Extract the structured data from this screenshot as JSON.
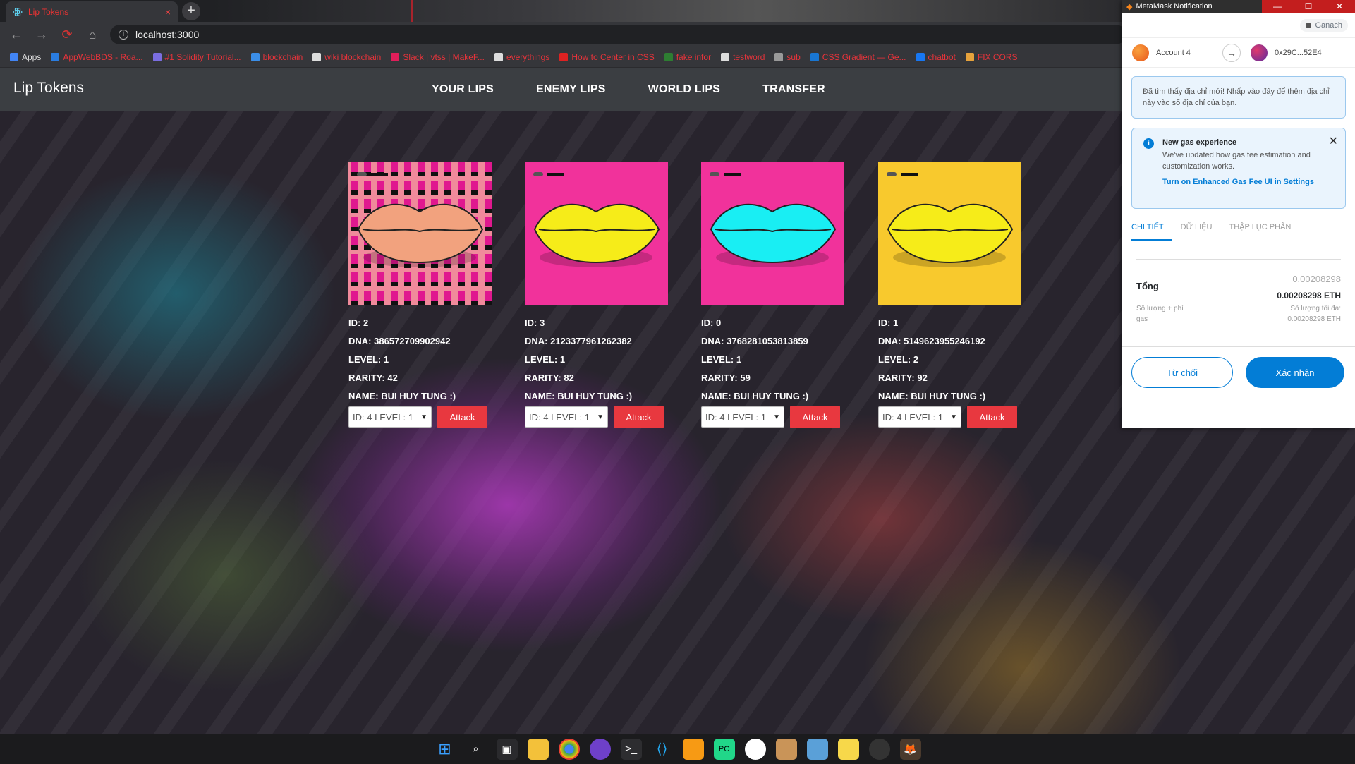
{
  "browser": {
    "tab_title": "Lip Tokens",
    "tab_close": "×",
    "new_tab": "+",
    "url": "localhost:3000",
    "bookmarks": [
      {
        "label": "Apps",
        "color": "#4285f4"
      },
      {
        "label": "AppWebBDS - Roa...",
        "color": "#2a7de1"
      },
      {
        "label": "#1 Solidity Tutorial...",
        "color": "#7b6ee0"
      },
      {
        "label": "blockchain",
        "color": "#3b8ee8"
      },
      {
        "label": "wiki blockchain",
        "color": "#dddddd"
      },
      {
        "label": "Slack | vtss | MakeF...",
        "color": "#e01e5a"
      },
      {
        "label": "everythings",
        "color": "#dddddd"
      },
      {
        "label": "How to Center in CSS",
        "color": "#d22"
      },
      {
        "label": "fake infor",
        "color": "#2e7d32"
      },
      {
        "label": "testword",
        "color": "#dddddd"
      },
      {
        "label": "sub",
        "color": "#999999"
      },
      {
        "label": "CSS Gradient — Ge...",
        "color": "#1976d2"
      },
      {
        "label": "chatbot",
        "color": "#1877f2"
      },
      {
        "label": "FIX CORS",
        "color": "#e6a23c"
      }
    ]
  },
  "app": {
    "brand": "Lip Tokens",
    "nav": [
      "YOUR LIPS",
      "ENEMY LIPS",
      "WORLD LIPS",
      "TRANSFER"
    ]
  },
  "cards": [
    {
      "id": "ID: 2",
      "dna": "DNA: 386572709902942",
      "level": "LEVEL: 1",
      "rarity": "RARITY: 42",
      "name": "NAME: BUI HUY TUNG :)",
      "select": "ID: 4 LEVEL: 1",
      "attack": "Attack",
      "bg": "#f08a9b",
      "lip": "#f2a27e",
      "pattern": true
    },
    {
      "id": "ID: 3",
      "dna": "DNA: 2123377961262382",
      "level": "LEVEL: 1",
      "rarity": "RARITY: 82",
      "name": "NAME: BUI HUY TUNG :)",
      "select": "ID: 4 LEVEL: 1",
      "attack": "Attack",
      "bg": "#f1329b",
      "lip": "#f6ec19",
      "pattern": false
    },
    {
      "id": "ID: 0",
      "dna": "DNA: 3768281053813859",
      "level": "LEVEL: 1",
      "rarity": "RARITY: 59",
      "name": "NAME: BUI HUY TUNG :)",
      "select": "ID: 4 LEVEL: 1",
      "attack": "Attack",
      "bg": "#f1329b",
      "lip": "#19eef3",
      "pattern": false
    },
    {
      "id": "ID: 1",
      "dna": "DNA: 5149623955246192",
      "level": "LEVEL: 2",
      "rarity": "RARITY: 92",
      "name": "NAME: BUI HUY TUNG :)",
      "select": "ID: 4 LEVEL: 1",
      "attack": "Attack",
      "bg": "#f8c92d",
      "lip": "#f6ec19",
      "pattern": false
    }
  ],
  "metamask": {
    "window_title": "MetaMask Notification",
    "network": "Ganach",
    "account_from": "Account 4",
    "account_to": "0x29C...52E4",
    "notice_new_address": "Đã tìm thấy địa chỉ mới! Nhấp vào đây để thêm địa chỉ này vào sổ địa chỉ của bạn.",
    "gas_title": "New gas experience",
    "gas_body": "We've updated how gas fee estimation and customization works.",
    "gas_link": "Turn on Enhanced Gas Fee UI in Settings",
    "tabs": [
      "CHI TIẾT",
      "DỮ LIỆU",
      "THẬP LỤC PHÂN"
    ],
    "total_label": "Tổng",
    "total_gray": "0.00208298",
    "total_eth": "0.00208298 ETH",
    "amount_gas_label": "Số lượng + phí gas",
    "max_label": "Số lượng tối đa:",
    "max_value": "0.00208298 ETH",
    "reject": "Từ chối",
    "confirm": "Xác nhận"
  }
}
